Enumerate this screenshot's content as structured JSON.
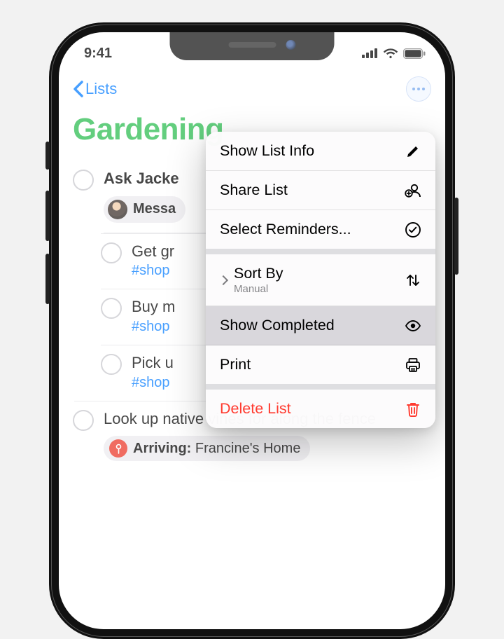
{
  "status": {
    "time": "9:41"
  },
  "nav": {
    "back": "Lists"
  },
  "list": {
    "title": "Gardening"
  },
  "reminders": [
    {
      "title": "Ask Jacke",
      "bold": true
    },
    {
      "title": "Get gr",
      "tag": "#shop"
    },
    {
      "title": "Buy m",
      "tag": "#shop"
    },
    {
      "title": "Pick u",
      "tag": "#shop"
    },
    {
      "title": "Look up native vines for along the fence"
    }
  ],
  "message_pill": {
    "label": "Messa"
  },
  "location_pill": {
    "prefix": "Arriving:",
    "place": "Francine's Home"
  },
  "menu": {
    "show_info": "Show List Info",
    "share": "Share List",
    "select": "Select Reminders...",
    "sort": "Sort By",
    "sort_sub": "Manual",
    "show_completed": "Show Completed",
    "print": "Print",
    "delete": "Delete List"
  }
}
